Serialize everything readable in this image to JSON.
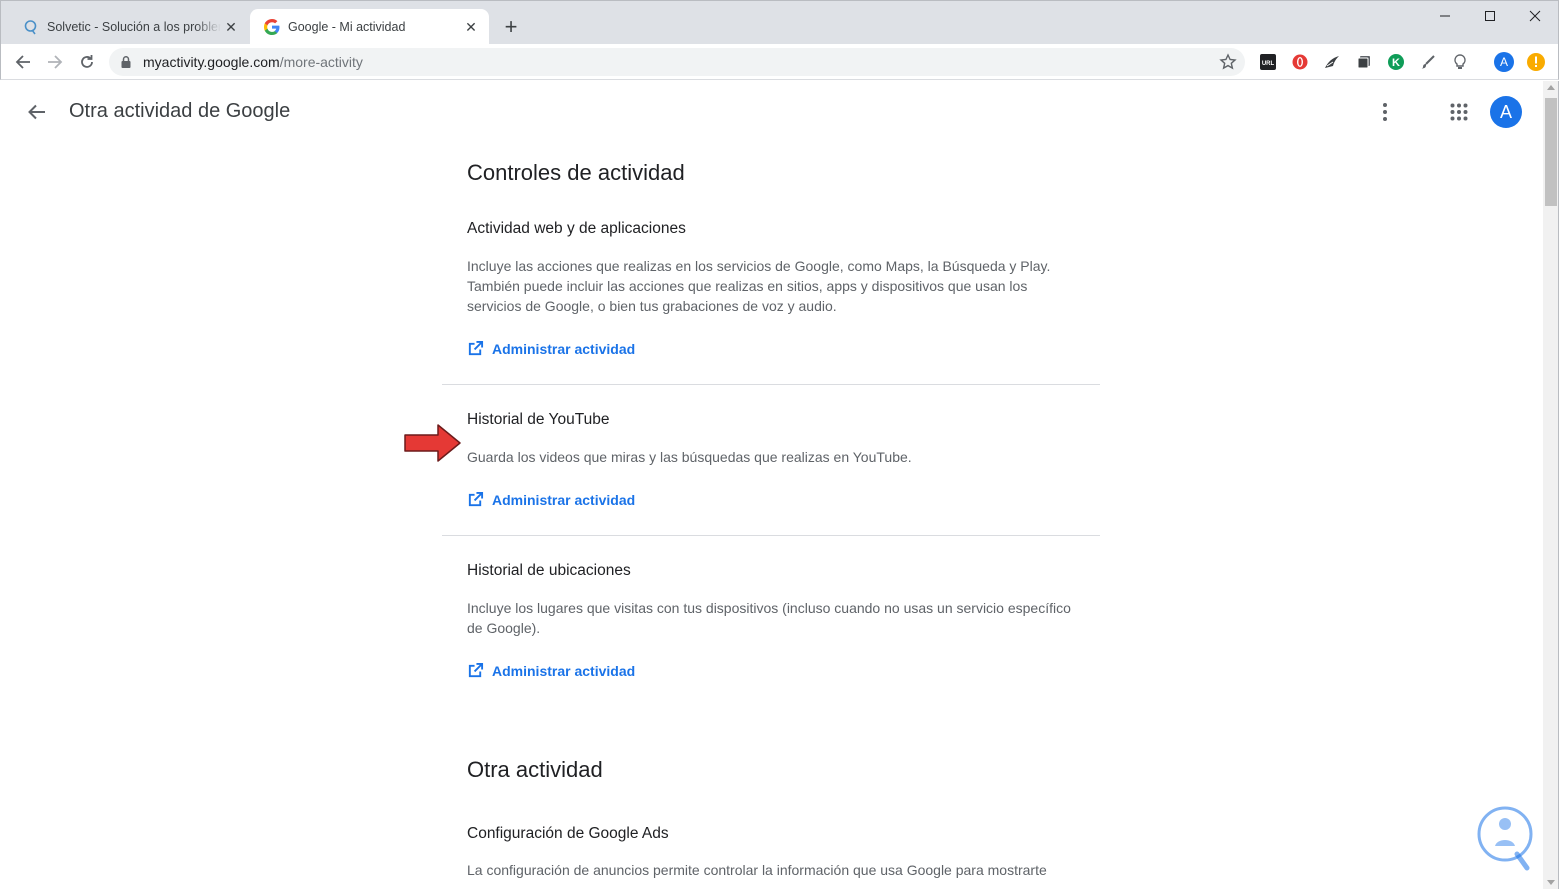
{
  "browser": {
    "tabs": [
      {
        "title": "Solvetic - Solución a los problem",
        "favicon": "solvetic-icon",
        "active": false
      },
      {
        "title": "Google - Mi actividad",
        "favicon": "google-g-icon",
        "active": true
      }
    ],
    "new_tab_label": "+",
    "url_domain": "myactivity.google.com",
    "url_path": "/more-activity",
    "profile_initial": "A",
    "extensions": [
      "url-extension-icon",
      "opera-extension-icon",
      "sparrow-extension-icon",
      "tab-extension-icon",
      "k-extension-icon",
      "brush-extension-icon",
      "bulb-extension-icon"
    ]
  },
  "header": {
    "title": "Otra actividad de Google",
    "avatar_initial": "A"
  },
  "activity_controls": {
    "heading": "Controles de actividad",
    "items": [
      {
        "title": "Actividad web y de aplicaciones",
        "description": "Incluye las acciones que realizas en los servicios de Google, como Maps, la Búsqueda y Play. También puede incluir las acciones que realizas en sitios, apps y dispositivos que usan los servicios de Google, o bien tus grabaciones de voz y audio.",
        "link": "Administrar actividad"
      },
      {
        "title": "Historial de YouTube",
        "description": "Guarda los videos que miras y las búsquedas que realizas en YouTube.",
        "link": "Administrar actividad"
      },
      {
        "title": "Historial de ubicaciones",
        "description": "Incluye los lugares que visitas con tus dispositivos (incluso cuando no usas un servicio específico de Google).",
        "link": "Administrar actividad"
      }
    ]
  },
  "other_activity": {
    "heading": "Otra actividad",
    "items": [
      {
        "title": "Configuración de Google Ads",
        "description": "La configuración de anuncios permite controlar la información que usa Google para mostrarte"
      }
    ]
  },
  "colors": {
    "link_blue": "#1a73e8",
    "annotation_arrow": "#e53935",
    "watermark_blue": "#1a73e8"
  }
}
